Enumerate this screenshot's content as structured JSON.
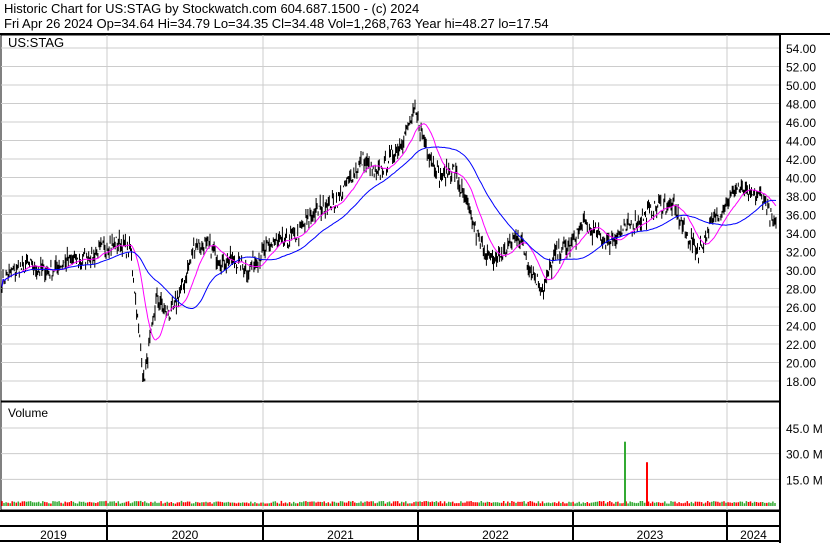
{
  "header": {
    "title": "Historic Chart for US:STAG by Stockwatch.com 604.687.1500 - (c) 2024",
    "quote": "Fri Apr 26 2024   Op=34.64  Hi=34.79  Lo=34.35   Cl=34.48  Vol=1,268,763   Year hi=48.27  lo=17.54"
  },
  "chart_data": {
    "type": "line",
    "title": "US:STAG",
    "ylim": [
      16,
      55
    ],
    "y_ticks": [
      "54.00",
      "52.00",
      "50.00",
      "48.00",
      "46.00",
      "44.00",
      "42.00",
      "40.00",
      "38.00",
      "36.00",
      "34.00",
      "32.00",
      "30.00",
      "28.00",
      "26.00",
      "24.00",
      "22.00",
      "20.00",
      "18.00"
    ],
    "x_labels": [
      "2019",
      "2020",
      "2021",
      "2022",
      "2023",
      "2024"
    ],
    "monthly_close": [
      29,
      30,
      30.5,
      30,
      30,
      31,
      31,
      31.5,
      32.5,
      33,
      32,
      18,
      27,
      25,
      28,
      33,
      32.5,
      31,
      31,
      30,
      31.5,
      33,
      33,
      34,
      36,
      37,
      37.5,
      40,
      42,
      40,
      42,
      44,
      47,
      43,
      40,
      41,
      37,
      33,
      31,
      32,
      34,
      30,
      28,
      32,
      32.5,
      35,
      34,
      33,
      34,
      35,
      36,
      37,
      37,
      34,
      32,
      35,
      37,
      39,
      38,
      38,
      34.5
    ],
    "series": [
      {
        "name": "Price",
        "color": "#000000"
      },
      {
        "name": "Short MA",
        "color": "#ff00ff"
      },
      {
        "name": "Long MA",
        "color": "#0000ff"
      }
    ],
    "volume": {
      "label": "Volume",
      "y_ticks": [
        "45.0 M",
        "30.0 M",
        "15.0 M"
      ],
      "ylim": [
        0,
        52
      ],
      "spikes_millions": [
        37,
        25
      ],
      "up_color": "#33aa33",
      "down_color": "#ff0000"
    }
  }
}
